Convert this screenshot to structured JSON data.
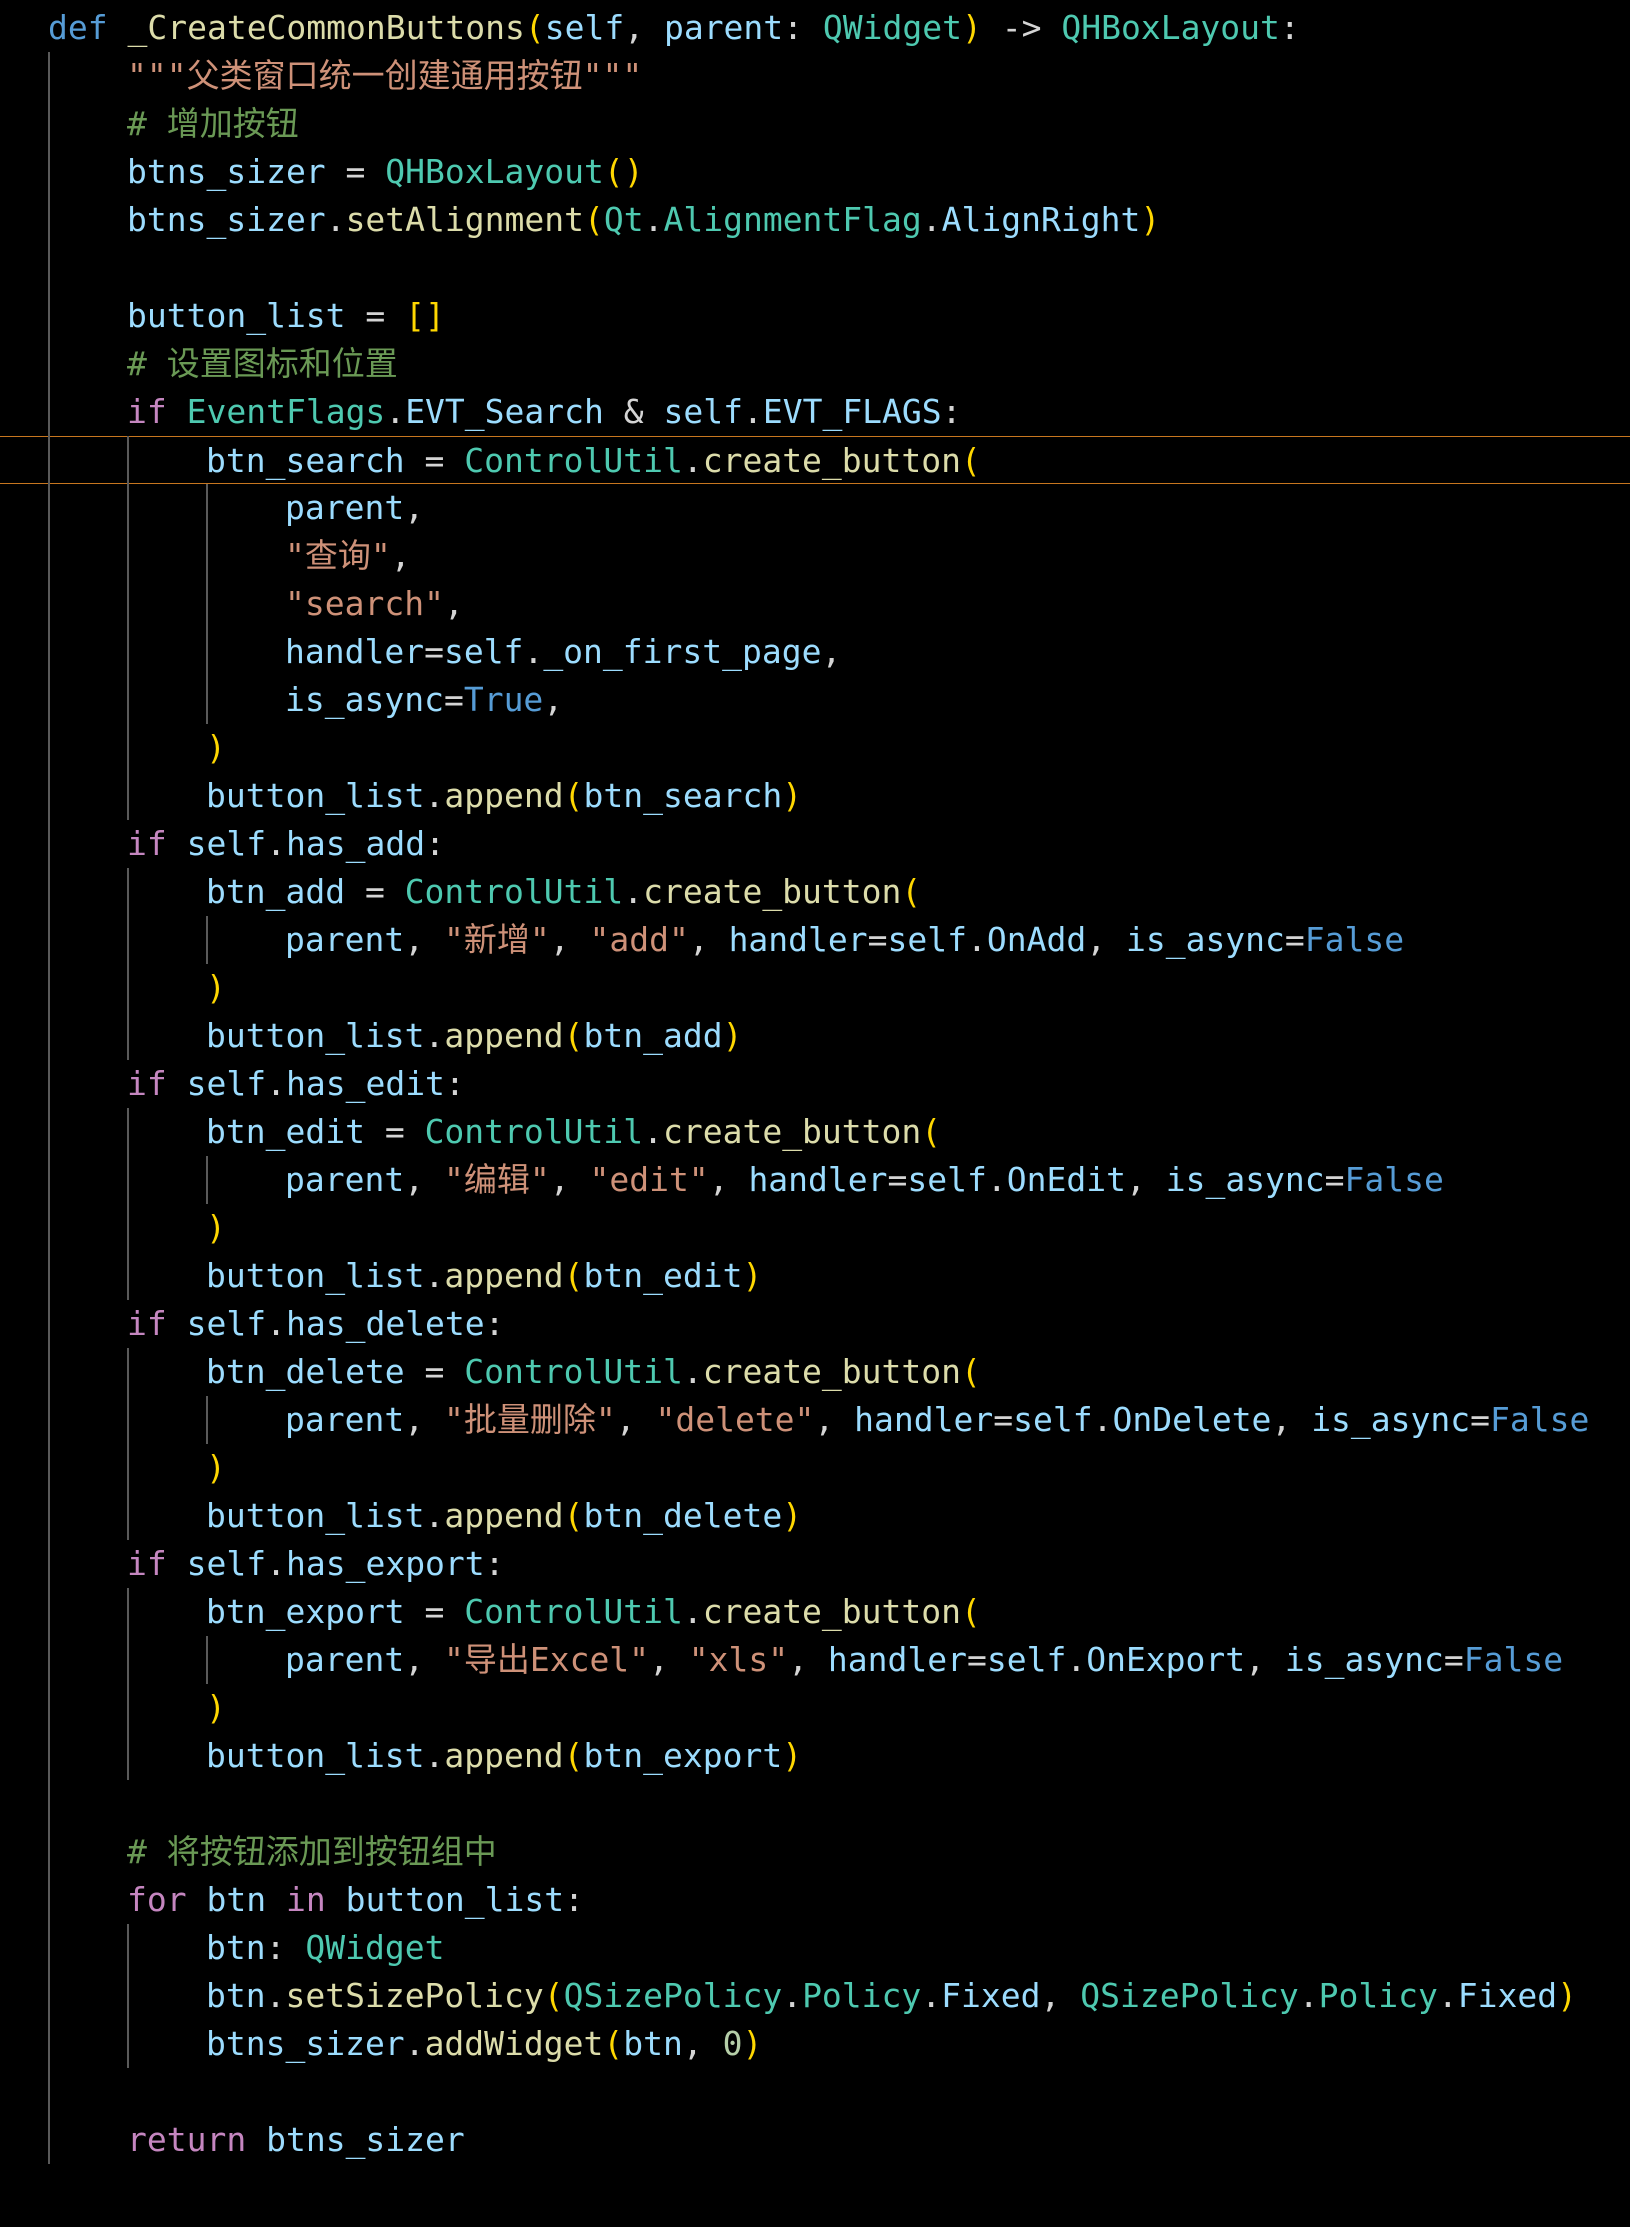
{
  "editor": {
    "theme_colors": {
      "background": "#000000",
      "keyword": "#569cd6",
      "control": "#c586c0",
      "function": "#dcdcaa",
      "variable": "#9cdcfe",
      "type": "#4ec9b0",
      "string": "#ce9178",
      "comment": "#6a9955",
      "number": "#b5cea8",
      "bracket": "#ffd700",
      "current_line_border": "#c7761f"
    },
    "current_line_index": 9,
    "lines": [
      {
        "indent": 0,
        "tokens": [
          [
            "kw",
            "def"
          ],
          [
            "op",
            " "
          ],
          [
            "fn",
            "_CreateCommonButtons"
          ],
          [
            "p1",
            "("
          ],
          [
            "var",
            "self"
          ],
          [
            "op",
            ", "
          ],
          [
            "var",
            "parent"
          ],
          [
            "op",
            ": "
          ],
          [
            "type",
            "QWidget"
          ],
          [
            "p1",
            ")"
          ],
          [
            "op",
            " -> "
          ],
          [
            "type",
            "QHBoxLayout"
          ],
          [
            "op",
            ":"
          ]
        ]
      },
      {
        "indent": 1,
        "tokens": [
          [
            "str",
            "\"\"\"父类窗口统一创建通用按钮\"\"\""
          ]
        ]
      },
      {
        "indent": 1,
        "tokens": [
          [
            "com",
            "# 增加按钮"
          ]
        ]
      },
      {
        "indent": 1,
        "tokens": [
          [
            "var",
            "btns_sizer"
          ],
          [
            "op",
            " = "
          ],
          [
            "type",
            "QHBoxLayout"
          ],
          [
            "p1",
            "()"
          ]
        ]
      },
      {
        "indent": 1,
        "tokens": [
          [
            "var",
            "btns_sizer"
          ],
          [
            "op",
            "."
          ],
          [
            "fn",
            "setAlignment"
          ],
          [
            "p1",
            "("
          ],
          [
            "type",
            "Qt"
          ],
          [
            "op",
            "."
          ],
          [
            "type",
            "AlignmentFlag"
          ],
          [
            "op",
            "."
          ],
          [
            "var",
            "AlignRight"
          ],
          [
            "p1",
            ")"
          ]
        ]
      },
      {
        "indent": 0,
        "tokens": []
      },
      {
        "indent": 1,
        "tokens": [
          [
            "var",
            "button_list"
          ],
          [
            "op",
            " = "
          ],
          [
            "p1",
            "[]"
          ]
        ]
      },
      {
        "indent": 1,
        "tokens": [
          [
            "com",
            "# 设置图标和位置"
          ]
        ]
      },
      {
        "indent": 1,
        "tokens": [
          [
            "ctl",
            "if"
          ],
          [
            "op",
            " "
          ],
          [
            "type",
            "EventFlags"
          ],
          [
            "op",
            "."
          ],
          [
            "var",
            "EVT_Search"
          ],
          [
            "op",
            " & "
          ],
          [
            "var",
            "self"
          ],
          [
            "op",
            "."
          ],
          [
            "var",
            "EVT_FLAGS"
          ],
          [
            "op",
            ":"
          ]
        ]
      },
      {
        "indent": 2,
        "tokens": [
          [
            "var",
            "btn_search"
          ],
          [
            "op",
            " = "
          ],
          [
            "type",
            "ControlUtil"
          ],
          [
            "op",
            "."
          ],
          [
            "fn",
            "create_button"
          ],
          [
            "p1",
            "("
          ]
        ]
      },
      {
        "indent": 3,
        "tokens": [
          [
            "var",
            "parent"
          ],
          [
            "op",
            ","
          ]
        ]
      },
      {
        "indent": 3,
        "tokens": [
          [
            "str",
            "\"查询\""
          ],
          [
            "op",
            ","
          ]
        ]
      },
      {
        "indent": 3,
        "tokens": [
          [
            "str",
            "\"search\""
          ],
          [
            "op",
            ","
          ]
        ]
      },
      {
        "indent": 3,
        "tokens": [
          [
            "var",
            "handler"
          ],
          [
            "op",
            "="
          ],
          [
            "var",
            "self"
          ],
          [
            "op",
            "."
          ],
          [
            "var",
            "_on_first_page"
          ],
          [
            "op",
            ","
          ]
        ]
      },
      {
        "indent": 3,
        "tokens": [
          [
            "var",
            "is_async"
          ],
          [
            "op",
            "="
          ],
          [
            "const",
            "True"
          ],
          [
            "op",
            ","
          ]
        ]
      },
      {
        "indent": 2,
        "tokens": [
          [
            "p1",
            ")"
          ]
        ]
      },
      {
        "indent": 2,
        "tokens": [
          [
            "var",
            "button_list"
          ],
          [
            "op",
            "."
          ],
          [
            "fn",
            "append"
          ],
          [
            "p1",
            "("
          ],
          [
            "var",
            "btn_search"
          ],
          [
            "p1",
            ")"
          ]
        ]
      },
      {
        "indent": 1,
        "tokens": [
          [
            "ctl",
            "if"
          ],
          [
            "op",
            " "
          ],
          [
            "var",
            "self"
          ],
          [
            "op",
            "."
          ],
          [
            "var",
            "has_add"
          ],
          [
            "op",
            ":"
          ]
        ]
      },
      {
        "indent": 2,
        "tokens": [
          [
            "var",
            "btn_add"
          ],
          [
            "op",
            " = "
          ],
          [
            "type",
            "ControlUtil"
          ],
          [
            "op",
            "."
          ],
          [
            "fn",
            "create_button"
          ],
          [
            "p1",
            "("
          ]
        ]
      },
      {
        "indent": 3,
        "tokens": [
          [
            "var",
            "parent"
          ],
          [
            "op",
            ", "
          ],
          [
            "str",
            "\"新增\""
          ],
          [
            "op",
            ", "
          ],
          [
            "str",
            "\"add\""
          ],
          [
            "op",
            ", "
          ],
          [
            "var",
            "handler"
          ],
          [
            "op",
            "="
          ],
          [
            "var",
            "self"
          ],
          [
            "op",
            "."
          ],
          [
            "var",
            "OnAdd"
          ],
          [
            "op",
            ", "
          ],
          [
            "var",
            "is_async"
          ],
          [
            "op",
            "="
          ],
          [
            "const",
            "False"
          ]
        ]
      },
      {
        "indent": 2,
        "tokens": [
          [
            "p1",
            ")"
          ]
        ]
      },
      {
        "indent": 2,
        "tokens": [
          [
            "var",
            "button_list"
          ],
          [
            "op",
            "."
          ],
          [
            "fn",
            "append"
          ],
          [
            "p1",
            "("
          ],
          [
            "var",
            "btn_add"
          ],
          [
            "p1",
            ")"
          ]
        ]
      },
      {
        "indent": 1,
        "tokens": [
          [
            "ctl",
            "if"
          ],
          [
            "op",
            " "
          ],
          [
            "var",
            "self"
          ],
          [
            "op",
            "."
          ],
          [
            "var",
            "has_edit"
          ],
          [
            "op",
            ":"
          ]
        ]
      },
      {
        "indent": 2,
        "tokens": [
          [
            "var",
            "btn_edit"
          ],
          [
            "op",
            " = "
          ],
          [
            "type",
            "ControlUtil"
          ],
          [
            "op",
            "."
          ],
          [
            "fn",
            "create_button"
          ],
          [
            "p1",
            "("
          ]
        ]
      },
      {
        "indent": 3,
        "tokens": [
          [
            "var",
            "parent"
          ],
          [
            "op",
            ", "
          ],
          [
            "str",
            "\"编辑\""
          ],
          [
            "op",
            ", "
          ],
          [
            "str",
            "\"edit\""
          ],
          [
            "op",
            ", "
          ],
          [
            "var",
            "handler"
          ],
          [
            "op",
            "="
          ],
          [
            "var",
            "self"
          ],
          [
            "op",
            "."
          ],
          [
            "var",
            "OnEdit"
          ],
          [
            "op",
            ", "
          ],
          [
            "var",
            "is_async"
          ],
          [
            "op",
            "="
          ],
          [
            "const",
            "False"
          ]
        ]
      },
      {
        "indent": 2,
        "tokens": [
          [
            "p1",
            ")"
          ]
        ]
      },
      {
        "indent": 2,
        "tokens": [
          [
            "var",
            "button_list"
          ],
          [
            "op",
            "."
          ],
          [
            "fn",
            "append"
          ],
          [
            "p1",
            "("
          ],
          [
            "var",
            "btn_edit"
          ],
          [
            "p1",
            ")"
          ]
        ]
      },
      {
        "indent": 1,
        "tokens": [
          [
            "ctl",
            "if"
          ],
          [
            "op",
            " "
          ],
          [
            "var",
            "self"
          ],
          [
            "op",
            "."
          ],
          [
            "var",
            "has_delete"
          ],
          [
            "op",
            ":"
          ]
        ]
      },
      {
        "indent": 2,
        "tokens": [
          [
            "var",
            "btn_delete"
          ],
          [
            "op",
            " = "
          ],
          [
            "type",
            "ControlUtil"
          ],
          [
            "op",
            "."
          ],
          [
            "fn",
            "create_button"
          ],
          [
            "p1",
            "("
          ]
        ]
      },
      {
        "indent": 3,
        "tokens": [
          [
            "var",
            "parent"
          ],
          [
            "op",
            ", "
          ],
          [
            "str",
            "\"批量删除\""
          ],
          [
            "op",
            ", "
          ],
          [
            "str",
            "\"delete\""
          ],
          [
            "op",
            ", "
          ],
          [
            "var",
            "handler"
          ],
          [
            "op",
            "="
          ],
          [
            "var",
            "self"
          ],
          [
            "op",
            "."
          ],
          [
            "var",
            "OnDelete"
          ],
          [
            "op",
            ", "
          ],
          [
            "var",
            "is_async"
          ],
          [
            "op",
            "="
          ],
          [
            "const",
            "False"
          ]
        ]
      },
      {
        "indent": 2,
        "tokens": [
          [
            "p1",
            ")"
          ]
        ]
      },
      {
        "indent": 2,
        "tokens": [
          [
            "var",
            "button_list"
          ],
          [
            "op",
            "."
          ],
          [
            "fn",
            "append"
          ],
          [
            "p1",
            "("
          ],
          [
            "var",
            "btn_delete"
          ],
          [
            "p1",
            ")"
          ]
        ]
      },
      {
        "indent": 1,
        "tokens": [
          [
            "ctl",
            "if"
          ],
          [
            "op",
            " "
          ],
          [
            "var",
            "self"
          ],
          [
            "op",
            "."
          ],
          [
            "var",
            "has_export"
          ],
          [
            "op",
            ":"
          ]
        ]
      },
      {
        "indent": 2,
        "tokens": [
          [
            "var",
            "btn_export"
          ],
          [
            "op",
            " = "
          ],
          [
            "type",
            "ControlUtil"
          ],
          [
            "op",
            "."
          ],
          [
            "fn",
            "create_button"
          ],
          [
            "p1",
            "("
          ]
        ]
      },
      {
        "indent": 3,
        "tokens": [
          [
            "var",
            "parent"
          ],
          [
            "op",
            ", "
          ],
          [
            "str",
            "\"导出Excel\""
          ],
          [
            "op",
            ", "
          ],
          [
            "str",
            "\"xls\""
          ],
          [
            "op",
            ", "
          ],
          [
            "var",
            "handler"
          ],
          [
            "op",
            "="
          ],
          [
            "var",
            "self"
          ],
          [
            "op",
            "."
          ],
          [
            "var",
            "OnExport"
          ],
          [
            "op",
            ", "
          ],
          [
            "var",
            "is_async"
          ],
          [
            "op",
            "="
          ],
          [
            "const",
            "False"
          ]
        ]
      },
      {
        "indent": 2,
        "tokens": [
          [
            "p1",
            ")"
          ]
        ]
      },
      {
        "indent": 2,
        "tokens": [
          [
            "var",
            "button_list"
          ],
          [
            "op",
            "."
          ],
          [
            "fn",
            "append"
          ],
          [
            "p1",
            "("
          ],
          [
            "var",
            "btn_export"
          ],
          [
            "p1",
            ")"
          ]
        ]
      },
      {
        "indent": 0,
        "tokens": []
      },
      {
        "indent": 1,
        "tokens": [
          [
            "com",
            "# 将按钮添加到按钮组中"
          ]
        ]
      },
      {
        "indent": 1,
        "tokens": [
          [
            "ctl",
            "for"
          ],
          [
            "op",
            " "
          ],
          [
            "var",
            "btn"
          ],
          [
            "op",
            " "
          ],
          [
            "ctl",
            "in"
          ],
          [
            "op",
            " "
          ],
          [
            "var",
            "button_list"
          ],
          [
            "op",
            ":"
          ]
        ]
      },
      {
        "indent": 2,
        "tokens": [
          [
            "var",
            "btn"
          ],
          [
            "op",
            ": "
          ],
          [
            "type",
            "QWidget"
          ]
        ]
      },
      {
        "indent": 2,
        "tokens": [
          [
            "var",
            "btn"
          ],
          [
            "op",
            "."
          ],
          [
            "fn",
            "setSizePolicy"
          ],
          [
            "p1",
            "("
          ],
          [
            "type",
            "QSizePolicy"
          ],
          [
            "op",
            "."
          ],
          [
            "type",
            "Policy"
          ],
          [
            "op",
            "."
          ],
          [
            "var",
            "Fixed"
          ],
          [
            "op",
            ", "
          ],
          [
            "type",
            "QSizePolicy"
          ],
          [
            "op",
            "."
          ],
          [
            "type",
            "Policy"
          ],
          [
            "op",
            "."
          ],
          [
            "var",
            "Fixed"
          ],
          [
            "p1",
            ")"
          ]
        ]
      },
      {
        "indent": 2,
        "tokens": [
          [
            "var",
            "btns_sizer"
          ],
          [
            "op",
            "."
          ],
          [
            "fn",
            "addWidget"
          ],
          [
            "p1",
            "("
          ],
          [
            "var",
            "btn"
          ],
          [
            "op",
            ", "
          ],
          [
            "num",
            "0"
          ],
          [
            "p1",
            ")"
          ]
        ]
      },
      {
        "indent": 0,
        "tokens": []
      },
      {
        "indent": 1,
        "tokens": [
          [
            "ctl",
            "return"
          ],
          [
            "op",
            " "
          ],
          [
            "var",
            "btns_sizer"
          ]
        ]
      }
    ]
  }
}
